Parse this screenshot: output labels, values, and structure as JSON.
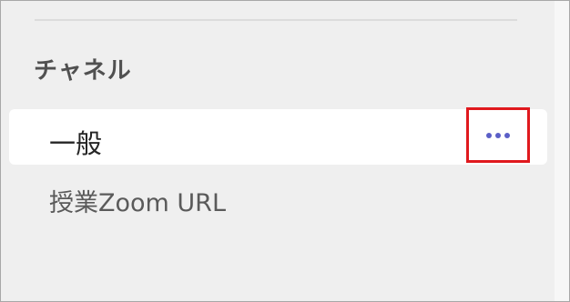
{
  "sidebar": {
    "section_title": "チャネル",
    "channels": [
      {
        "label": "一般",
        "selected": true,
        "more_options_icon": "more-horizontal-icon"
      },
      {
        "label": "授業Zoom URL",
        "selected": false
      }
    ]
  },
  "colors": {
    "accent": "#5b5fc7",
    "highlight_box": "#e0191e",
    "sidebar_bg": "#efefef",
    "selected_row_bg": "#ffffff"
  }
}
